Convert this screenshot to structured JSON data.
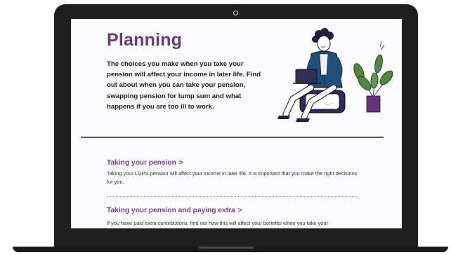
{
  "page": {
    "title": "Planning",
    "intro": "The choices you make when you take your pension will affect your income in later life. Find out about when you can take your pension, swapping pension for lump sum and what happens if you are too ill to work."
  },
  "sections": [
    {
      "link": "Taking your pension",
      "chevron": ">",
      "description": "Taking your LGPS pension will affect your income in later life. It is important that you make the right decisions for you."
    },
    {
      "link": "Taking your pension and paying extra",
      "chevron": ">",
      "description": "If you have paid extra contributions, find out how this will affect your benefits when you take your"
    }
  ],
  "illustration": {
    "icon": "person-with-laptop-and-plant-illustration"
  },
  "colors": {
    "accent": "#6e3582",
    "link": "#7a3d90",
    "bezel": "#1f1f1f",
    "jacket": "#1f4e79",
    "plant_leaf": "#4f8a3c",
    "plant_pot": "#6b2d7d"
  }
}
